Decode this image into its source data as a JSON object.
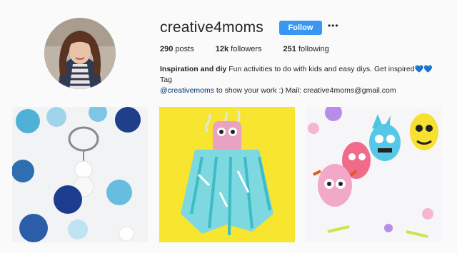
{
  "profile": {
    "username": "creative4moms",
    "follow_label": "Follow",
    "more_glyph": "•••",
    "stats": {
      "posts_count": "290",
      "posts_label": "posts",
      "followers_count": "12k",
      "followers_label": "followers",
      "following_count": "251",
      "following_label": "following"
    },
    "bio": {
      "name": "Inspiration and diy",
      "text1": " Fun activities to do with kids and easy diys. Get inspired",
      "hearts": "💙💙",
      "text2": " Tag",
      "mention": "@creativemoms",
      "text3": " to show your work :) Mail: creative4moms@gmail.com"
    }
  },
  "colors": {
    "follow_button": "#3897f0",
    "background": "#fafafa",
    "mention": "#003569"
  },
  "posts": [
    {
      "subject": "felt ball keychain"
    },
    {
      "subject": "tissue paper jellyfish"
    },
    {
      "subject": "painted egg monsters"
    }
  ]
}
